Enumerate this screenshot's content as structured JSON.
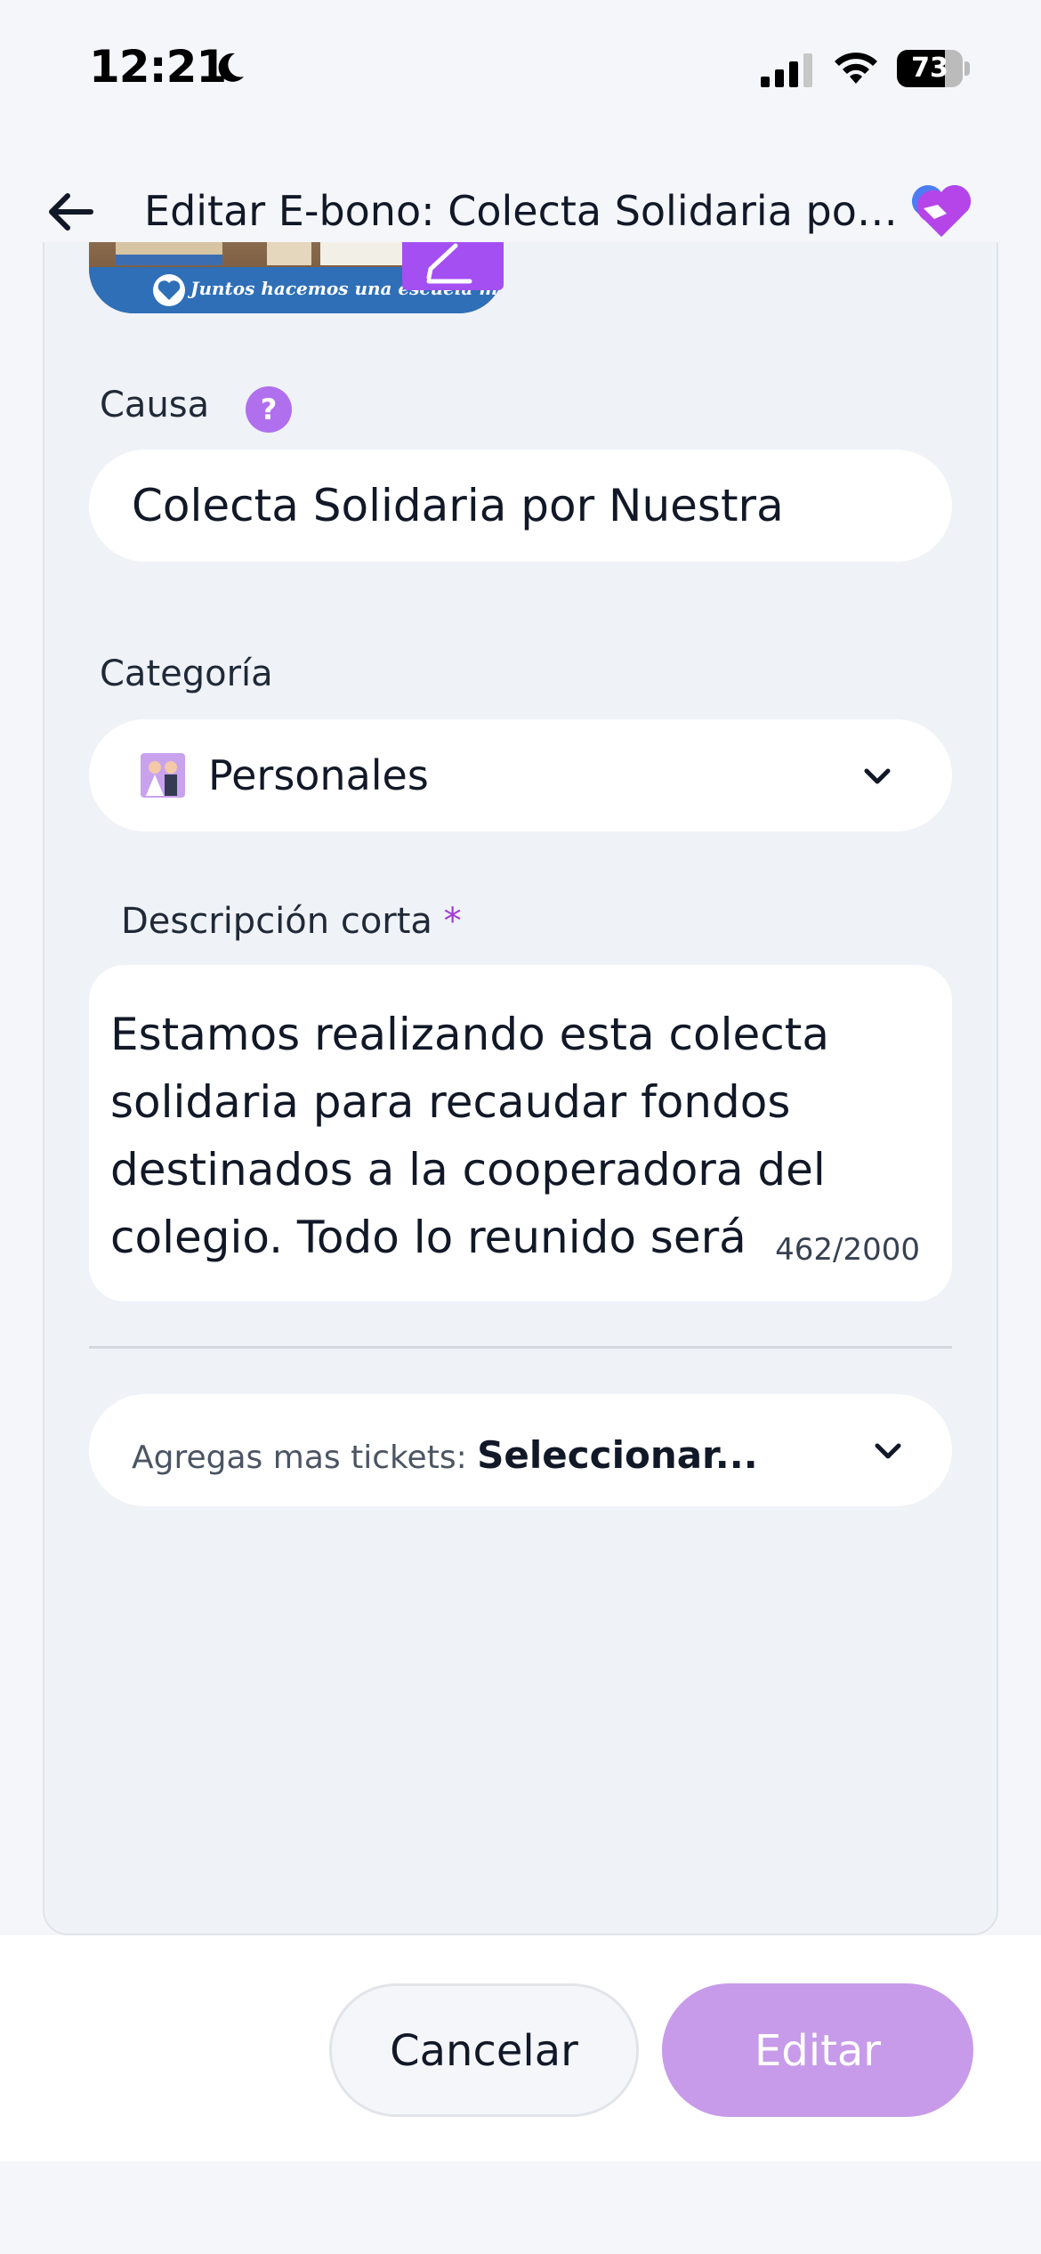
{
  "status_bar": {
    "time": "12:21",
    "battery_level": "73",
    "battery_fraction": 0.73
  },
  "header": {
    "title": "Editar E-bono: Colecta Solidaria por…",
    "back_icon": "arrow-left-icon",
    "logo_icon": "heart-hand-logo"
  },
  "banner": {
    "caption": "Juntos hacemos una escuela mejor ♡"
  },
  "form": {
    "causa": {
      "label": "Causa",
      "help_icon": "?",
      "value": "Colecta Solidaria por Nuestra"
    },
    "categoria": {
      "label": "Categoría",
      "value": "Personales",
      "emoji": "👰🤵"
    },
    "descripcion": {
      "label": "Descripción corta",
      "required_mark": "*",
      "value": "Estamos realizando esta colecta solidaria para recaudar fondos destinados a la cooperadora del colegio. Todo lo reunido será",
      "char_count": "462/2000"
    },
    "tickets": {
      "label": "Agregas mas tickets:",
      "value": "Seleccionar..."
    }
  },
  "footer": {
    "cancel_label": "Cancelar",
    "edit_label": "Editar"
  },
  "colors": {
    "accent": "#a44ff2",
    "edit_button_disabled": "#c79be9",
    "help_icon": "#b070ee",
    "required": "#a33bd8"
  }
}
